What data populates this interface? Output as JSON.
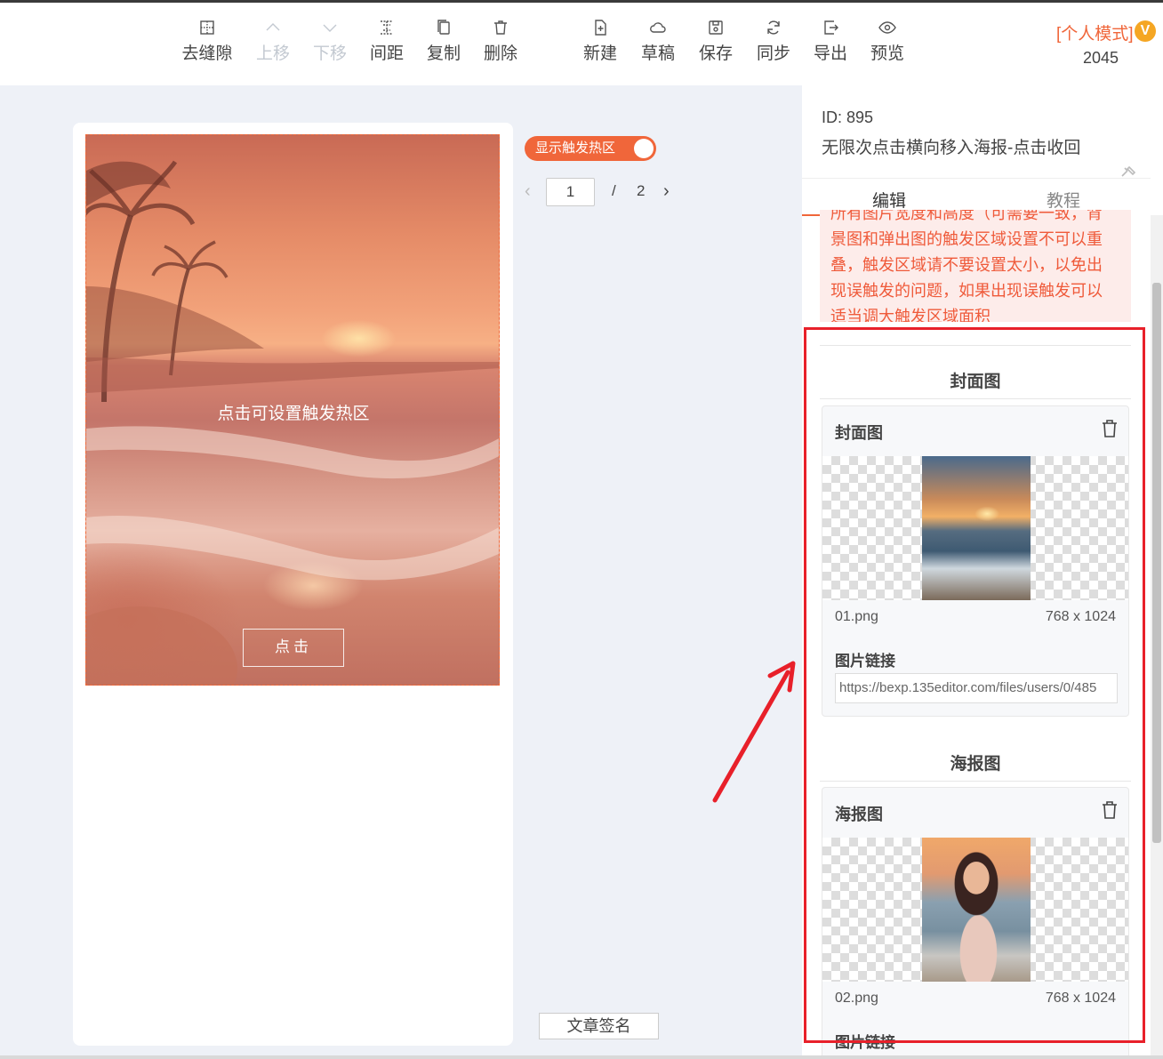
{
  "toolbar": {
    "items": [
      {
        "label": "去缝隙",
        "icon": "grid-dots-icon",
        "disabled": false
      },
      {
        "label": "上移",
        "icon": "chevron-up-icon",
        "disabled": true
      },
      {
        "label": "下移",
        "icon": "chevron-down-icon",
        "disabled": true
      },
      {
        "label": "间距",
        "icon": "spacing-icon",
        "disabled": false
      },
      {
        "label": "复制",
        "icon": "copy-icon",
        "disabled": false
      },
      {
        "label": "删除",
        "icon": "trash-icon",
        "disabled": false
      },
      {
        "label": "新建",
        "icon": "new-file-icon",
        "disabled": false
      },
      {
        "label": "草稿",
        "icon": "cloud-icon",
        "disabled": false
      },
      {
        "label": "保存",
        "icon": "save-icon",
        "disabled": false
      },
      {
        "label": "同步",
        "icon": "sync-icon",
        "disabled": false
      },
      {
        "label": "导出",
        "icon": "export-icon",
        "disabled": false
      },
      {
        "label": "预览",
        "icon": "eye-icon",
        "disabled": false
      }
    ],
    "mode_label": "[个人模式]",
    "mode_badge": "V",
    "mode_number": "2045"
  },
  "canvas": {
    "hotzone_hint": "点击可设置触发热区",
    "click_button": "点击",
    "toggle_label": "显示触发热区",
    "toggle_on": true,
    "pager": {
      "current": "1",
      "separator": "/",
      "total": "2"
    },
    "sign_button": "文章签名"
  },
  "panel": {
    "id_text": "ID: 895",
    "name": "无限次点击横向移入海报-点击收回",
    "tabs": [
      {
        "label": "编辑",
        "active": true
      },
      {
        "label": "教程",
        "active": false
      }
    ],
    "notice_lines": [
      "所有图片宽度和高度（可需要一致，背",
      "景图和弹出图的触发区域设置不可以重",
      "叠，触发区域请不要设置太小，以免出",
      "现误触发的问题，如果出现误触发可以",
      "适当调大触发区域面积"
    ],
    "sections": [
      {
        "heading": "封面图",
        "card_title": "封面图",
        "file_name": "01.png",
        "file_size": "768 x 1024",
        "link_label": "图片链接",
        "link_value": "https://bexp.135editor.com/files/users/0/485"
      },
      {
        "heading": "海报图",
        "card_title": "海报图",
        "file_name": "02.png",
        "file_size": "768 x 1024",
        "link_label": "图片链接",
        "link_value": ""
      }
    ]
  },
  "colors": {
    "accent": "#f0663a",
    "annotation": "#e8202a",
    "notice_bg": "#fdecea"
  }
}
